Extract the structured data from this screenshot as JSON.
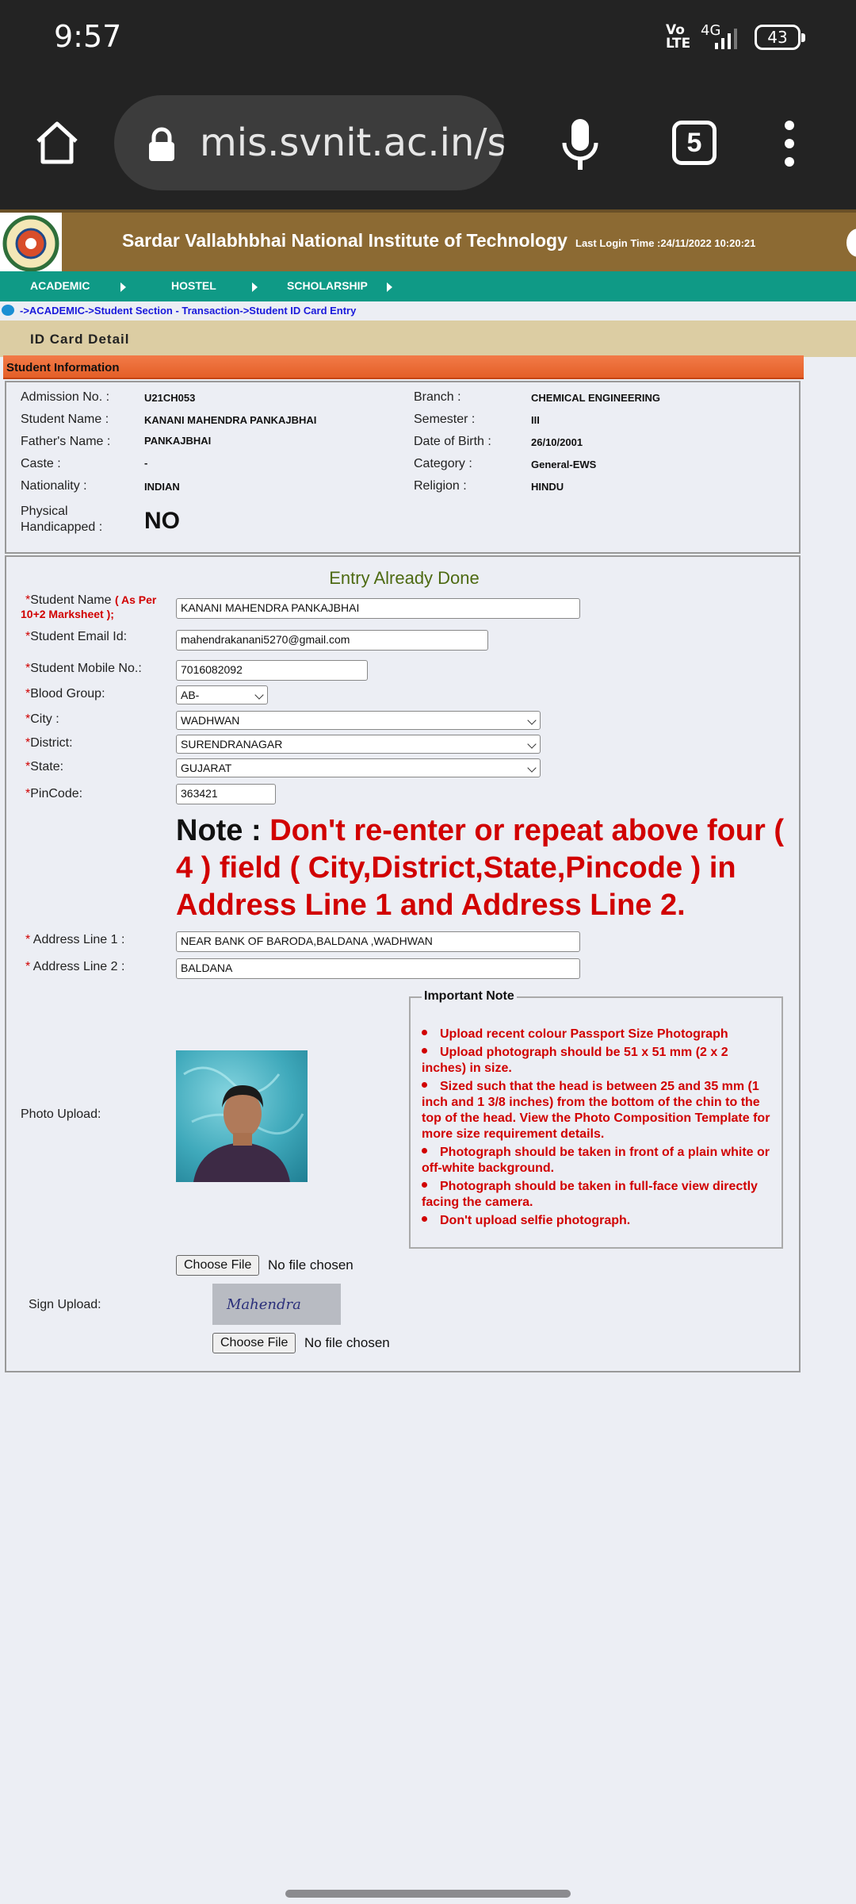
{
  "status_bar": {
    "time": "9:57",
    "volte": "Vo LTE",
    "network": "4G",
    "battery": "43"
  },
  "browser": {
    "url": "mis.svnit.ac.in/s",
    "tab_count": "5"
  },
  "site": {
    "institute": "Sardar Vallabhbhai National Institute of Technology",
    "last_login": "Last Login Time :24/11/2022 10:20:21"
  },
  "nav": {
    "items": [
      "ACADEMIC",
      "HOSTEL",
      "SCHOLARSHIP"
    ]
  },
  "breadcrumb": "->ACADEMIC->Student Section - Transaction->Student ID Card Entry",
  "section_title": "ID Card Detail",
  "student_info": {
    "title": "Student Information",
    "admission_label": "Admission No. :",
    "admission": "U21CH053",
    "name_label": "Student Name :",
    "name": "KANANI MAHENDRA PANKAJBHAI",
    "father_label": "Father's Name :",
    "father": "PANKAJBHAI",
    "caste_label": "Caste :",
    "caste": "-",
    "nationality_label": "Nationality :",
    "nationality": "INDIAN",
    "ph_label_1": "Physical",
    "ph_label_2": "Handicapped :",
    "ph": "NO",
    "branch_label": "Branch :",
    "branch": "CHEMICAL ENGINEERING",
    "semester_label": "Semester :",
    "semester": "III",
    "dob_label": "Date of Birth :",
    "dob": "26/10/2001",
    "category_label": "Category :",
    "category": "General-EWS",
    "religion_label": "Religion :",
    "religion": "HINDU"
  },
  "form": {
    "status": "Entry Already Done",
    "req_mark": "*",
    "student_name_label": "Student Name",
    "student_name_sub": "( As Per",
    "student_name_sub2": "10+2 Marksheet );",
    "student_name": "KANANI MAHENDRA PANKAJBHAI",
    "email_label": "Student Email Id:",
    "email": "mahendrakanani5270@gmail.com",
    "mobile_label": "Student Mobile No.:",
    "mobile": "7016082092",
    "blood_label": "Blood Group:",
    "blood": "AB-",
    "city_label": "City :",
    "city": "WADHWAN",
    "district_label": "District:",
    "district": "SURENDRANAGAR",
    "state_label": "State:",
    "state": "GUJARAT",
    "pin_label": "PinCode:",
    "pin": "363421",
    "note_head": "Note : ",
    "note_text": "Don't re-enter or repeat above four ( 4 ) field ( City,District,State,Pincode ) in Address Line 1 and Address Line 2.",
    "addr1_label": " Address Line 1 :",
    "addr1": "NEAR BANK OF BARODA,BALDANA ,WADHWAN",
    "addr2_label": " Address Line 2 :",
    "addr2": "BALDANA",
    "photo_label": "Photo Upload:",
    "sign_label": "Sign Upload:",
    "choose_file": "Choose File",
    "no_file": "No file chosen",
    "sign_preview": "Mahendra"
  },
  "important_note": {
    "title": "Important Note",
    "items": [
      "Upload recent colour Passport Size Photograph",
      "Upload photograph should be 51 x 51 mm (2 x 2 inches) in size.",
      "Sized such that the head is between 25 and 35 mm (1 inch and 1 3/8 inches) from the bottom of the chin to the top of the head. View the Photo Composition Template for more size requirement details.",
      "Photograph should be taken in front of a plain white or off-white background.",
      "Photograph should be taken in full-face view directly facing the camera.",
      "Don't upload selfie photograph."
    ]
  },
  "colors": {
    "banner": "#8c6a33",
    "nav": "#0f9a86",
    "section": "#dccda3",
    "accent_red": "#d10000"
  },
  "icons": [
    "home-icon",
    "lock-icon",
    "mic-icon",
    "tabs-icon",
    "menu-icon",
    "institute-logo",
    "breadcrumb-home-icon"
  ]
}
